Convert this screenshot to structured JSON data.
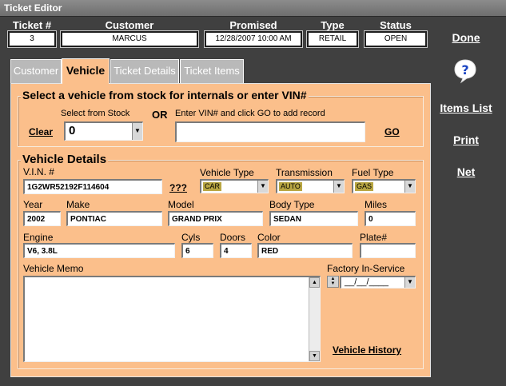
{
  "window": {
    "title": "Ticket Editor"
  },
  "header": {
    "ticket_label": "Ticket #",
    "ticket_value": "3",
    "customer_label": "Customer",
    "customer_value": "MARCUS",
    "promised_label": "Promised",
    "promised_value": "12/28/2007 10:00 AM",
    "type_label": "Type",
    "type_value": "RETAIL",
    "status_label": "Status",
    "status_value": "OPEN"
  },
  "side": {
    "done": "Done",
    "items_list": "Items List",
    "print": "Print",
    "net": "Net",
    "help_glyph": "?"
  },
  "tabs": [
    {
      "label": "Customer"
    },
    {
      "label": "Vehicle"
    },
    {
      "label": "Ticket Details"
    },
    {
      "label": "Ticket Items"
    }
  ],
  "select_section": {
    "title": "Select a vehicle from stock for internals or enter VIN#",
    "stock_label": "Select from Stock",
    "or_label": "OR",
    "vin_prompt": "Enter VIN# and click GO to add record",
    "clear": "Clear",
    "stock_value": "0",
    "vin_entry": "",
    "go": "GO"
  },
  "details": {
    "title": "Vehicle Details",
    "vin_label": "V.I.N. #",
    "vin_value": "1G2WR52192F114604",
    "vin_lookup": "???",
    "vehicle_type_label": "Vehicle Type",
    "vehicle_type_value": "CAR",
    "transmission_label": "Transmission",
    "transmission_value": "AUTO",
    "fuel_type_label": "Fuel Type",
    "fuel_type_value": "GAS",
    "year_label": "Year",
    "year_value": "2002",
    "make_label": "Make",
    "make_value": "PONTIAC",
    "model_label": "Model",
    "model_value": "GRAND PRIX",
    "body_type_label": "Body Type",
    "body_type_value": "SEDAN",
    "miles_label": "Miles",
    "miles_value": "0",
    "engine_label": "Engine",
    "engine_value": "V6, 3.8L",
    "cyls_label": "Cyls",
    "cyls_value": "6",
    "doors_label": "Doors",
    "doors_value": "4",
    "color_label": "Color",
    "color_value": "RED",
    "plate_label": "Plate#",
    "plate_value": "",
    "memo_label": "Vehicle Memo",
    "memo_value": "",
    "factory_label": "Factory In-Service",
    "factory_value": "__/__/____",
    "history_link": "Vehicle History"
  },
  "icons": {
    "help": "help-question-bubble-icon",
    "dropdown": "chevron-down-icon"
  },
  "colors": {
    "background": "#404040",
    "panel": "#fbbf8b",
    "tab_inactive": "#b9b9b9",
    "selected_highlight": "#b8a642"
  }
}
